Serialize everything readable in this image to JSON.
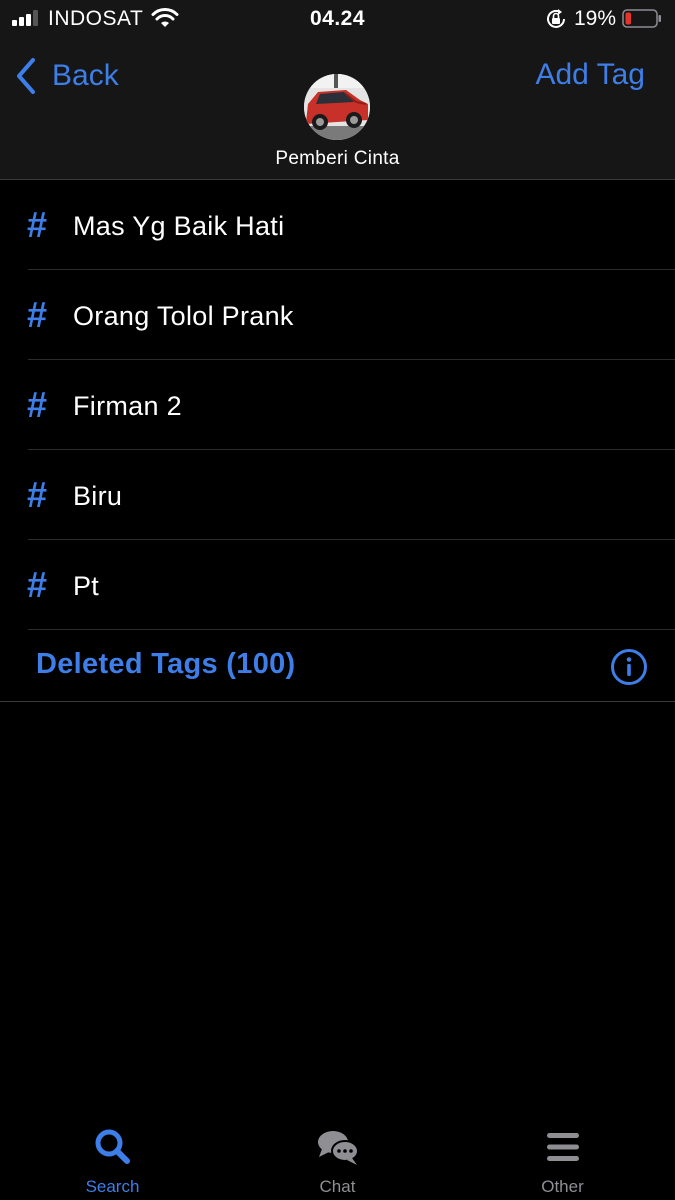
{
  "status_bar": {
    "carrier": "INDOSAT",
    "time": "04.24",
    "battery_percent": "19%",
    "battery_level": 0.19,
    "icons": [
      "signal-icon",
      "wifi-icon",
      "rotation-lock-icon",
      "battery-icon"
    ]
  },
  "nav": {
    "back_label": "Back",
    "add_tag_label": "Add Tag",
    "contact_name": "Pemberi Cinta",
    "avatar": "red car photo"
  },
  "tags": [
    {
      "hash": "#",
      "label": "Mas Yg Baik Hati"
    },
    {
      "hash": "#",
      "label": "Orang Tolol Prank"
    },
    {
      "hash": "#",
      "label": "Firman 2"
    },
    {
      "hash": "#",
      "label": "Biru"
    },
    {
      "hash": "#",
      "label": "Pt"
    }
  ],
  "deleted_tags": {
    "label": "Deleted Tags (100)"
  },
  "tab_bar": {
    "tabs": [
      {
        "label": "Search",
        "icon": "search-icon",
        "active": true
      },
      {
        "label": "Chat",
        "icon": "chat-bubbles-icon",
        "active": false
      },
      {
        "label": "Other",
        "icon": "menu-icon",
        "active": false
      }
    ]
  },
  "colors": {
    "accent": "#3d7ee8",
    "background": "#000000",
    "bar_background": "#161616",
    "battery_low": "#e5352b",
    "inactive": "#8e8e93"
  }
}
